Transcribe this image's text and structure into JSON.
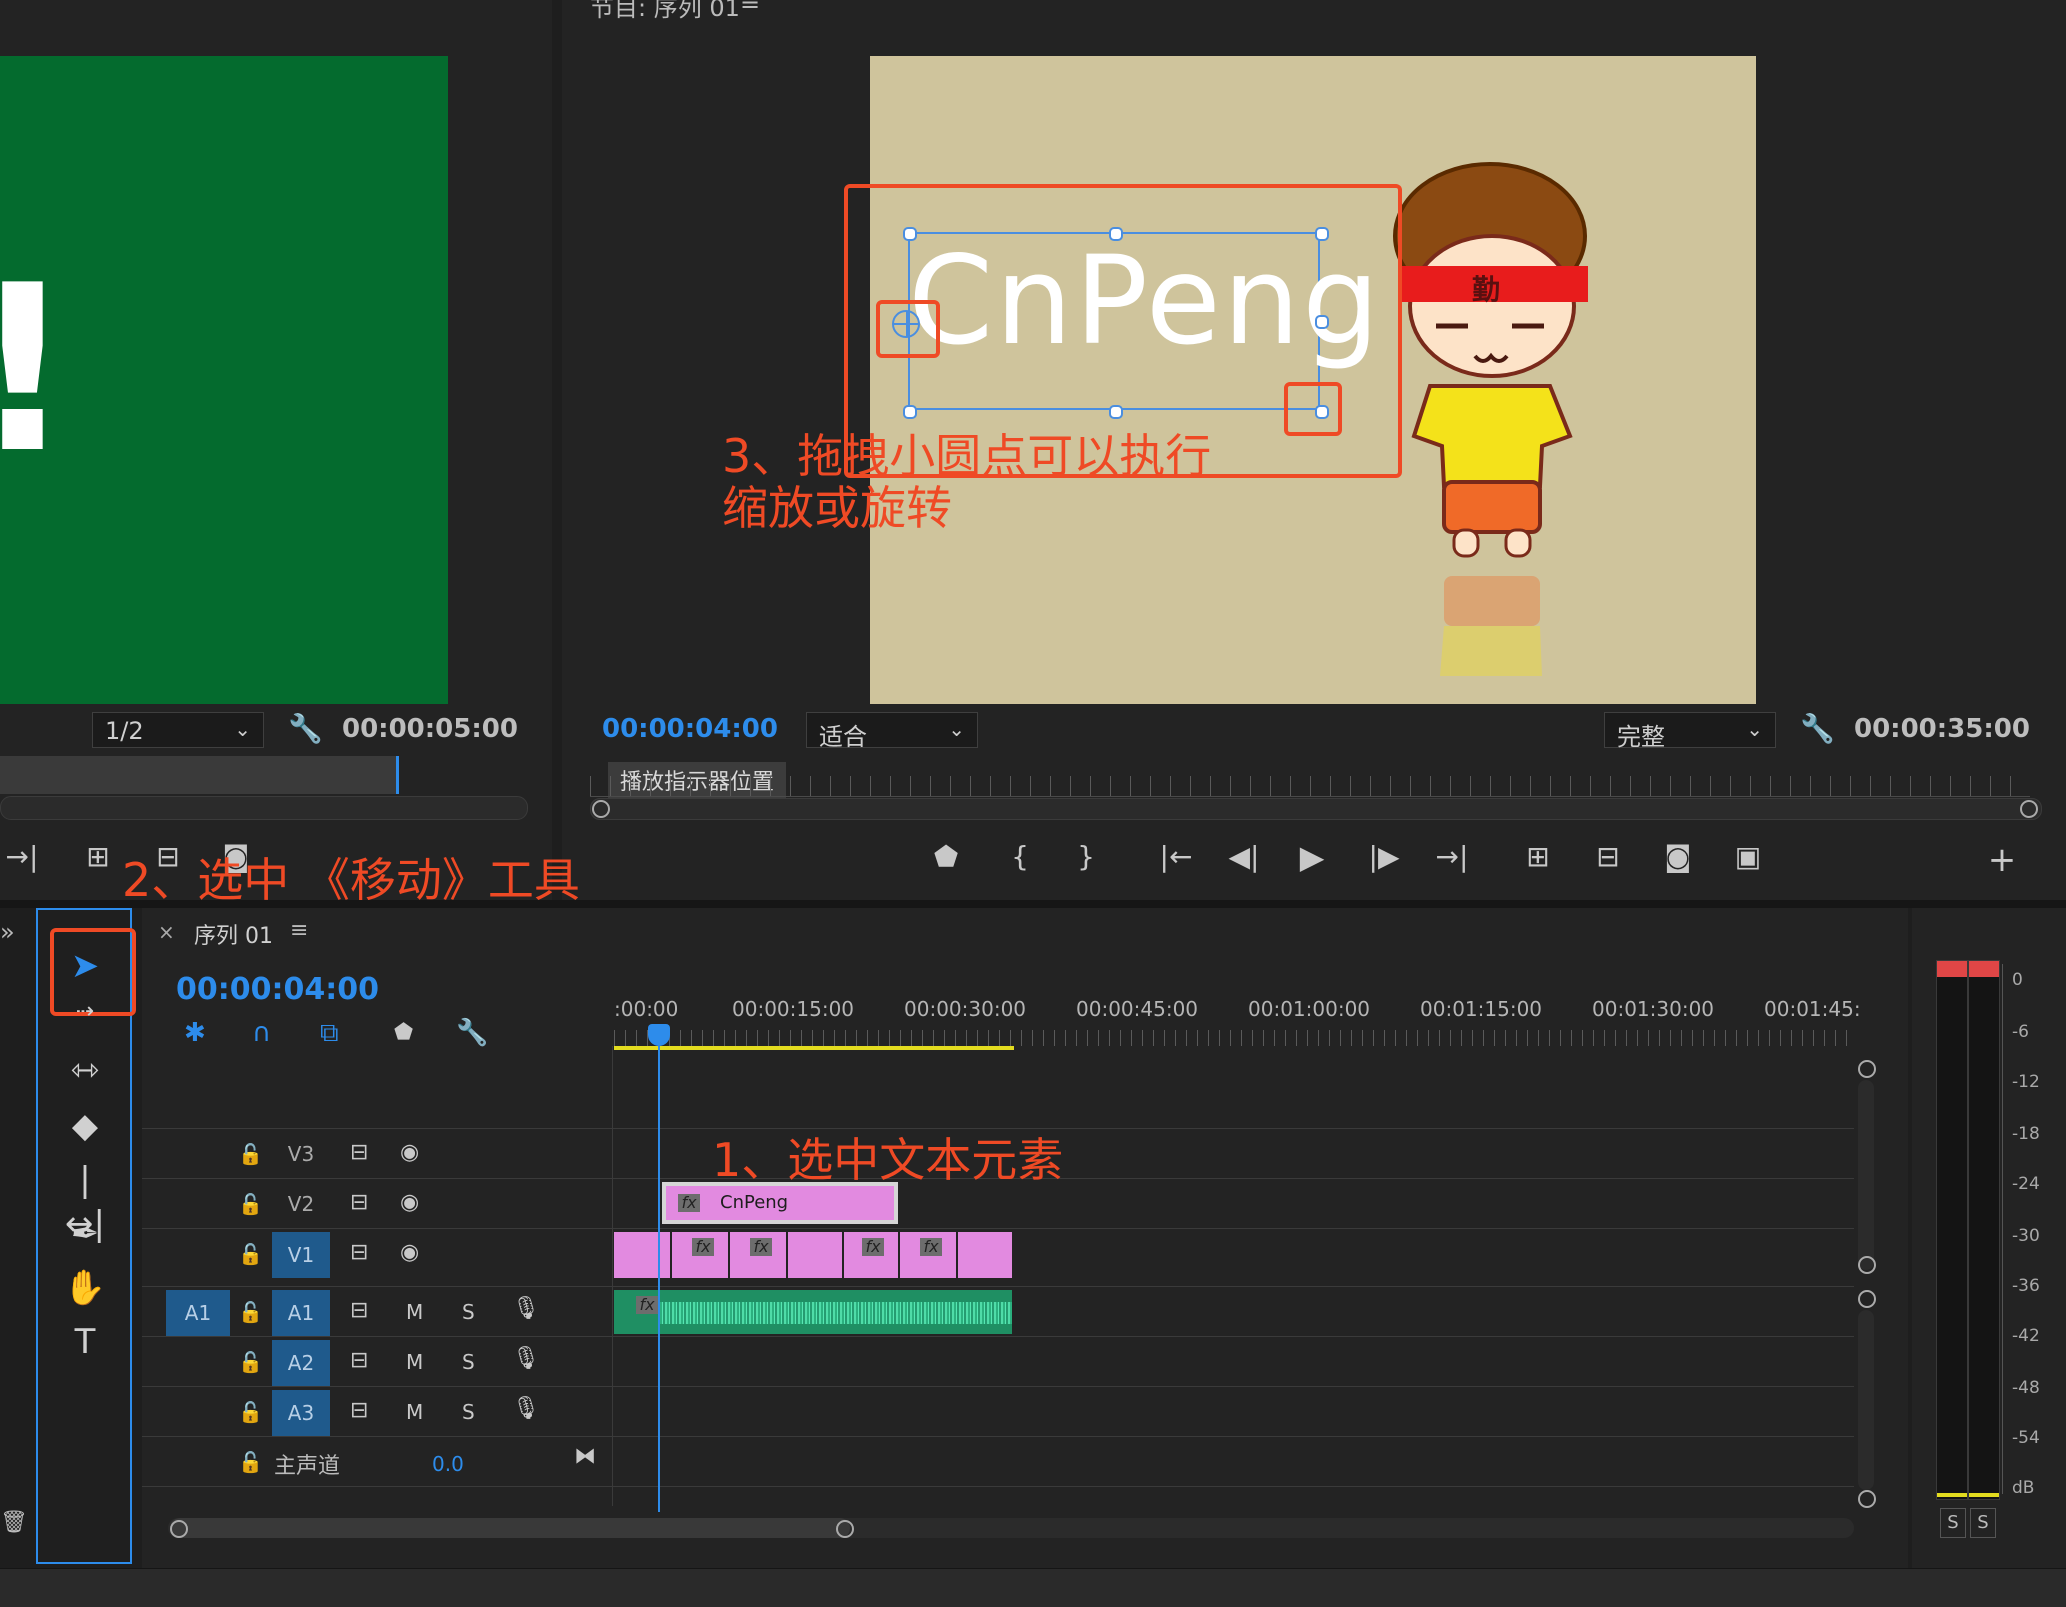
{
  "source_monitor": {
    "page_select": "1/2",
    "duration": "00:00:05:00",
    "preview_text": "!"
  },
  "program_monitor": {
    "title": "节目: 序列 01",
    "current_time": "00:00:04:00",
    "fit_select": "适合",
    "quality_select": "完整",
    "duration": "00:00:35:00",
    "tooltip": "播放指示器位置",
    "title_text": "CnPeng",
    "headband_char": "勤"
  },
  "annotations": {
    "step1": "1、选中文本元素",
    "step2": "2、选中 《移动》工具",
    "step3_line1": "3、拖拽小圆点可以执行",
    "step3_line2": "缩放或旋转"
  },
  "timeline": {
    "tab_label": "序列 01",
    "current_time": "00:00:04:00",
    "ruler": [
      ":00:00",
      "00:00:15:00",
      "00:00:30:00",
      "00:00:45:00",
      "00:01:00:00",
      "00:01:15:00",
      "00:01:30:00",
      "00:01:45:"
    ],
    "tracks": {
      "v3": "V3",
      "v2": "V2",
      "v1": "V1",
      "a1_source": "A1",
      "a1": "A1",
      "a2": "A2",
      "a3": "A3"
    },
    "mute": "M",
    "solo": "S",
    "master_label": "主声道",
    "master_value": "0.0",
    "text_clip_label": "CnPeng",
    "fx": "fx"
  },
  "meter": {
    "scale": [
      "0",
      "-6",
      "-12",
      "-18",
      "-24",
      "-30",
      "-36",
      "-42",
      "-48",
      "-54",
      "dB"
    ],
    "solo_left": "S",
    "solo_right": "S"
  },
  "colors": {
    "accent_blue": "#2d8ceb",
    "annotation_red": "#ef4a25",
    "clip_pink": "#e28ae0",
    "audio_green": "#2fbf8a",
    "track_blue": "#1f5a8c"
  }
}
